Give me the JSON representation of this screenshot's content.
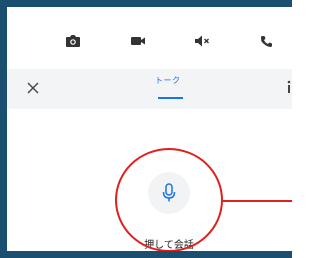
{
  "toolbar": {
    "icons": [
      "camera-icon",
      "video-icon",
      "volume-mute-icon",
      "phone-icon"
    ],
    "icon_color": "#333333"
  },
  "header": {
    "close_icon": "close-icon",
    "tab_label": "トーク",
    "accent_color": "#1a73e8"
  },
  "main": {
    "mic_icon": "microphone-icon",
    "push_to_talk_label": "押して会話"
  },
  "annotation": {
    "color": "#e0201c"
  }
}
